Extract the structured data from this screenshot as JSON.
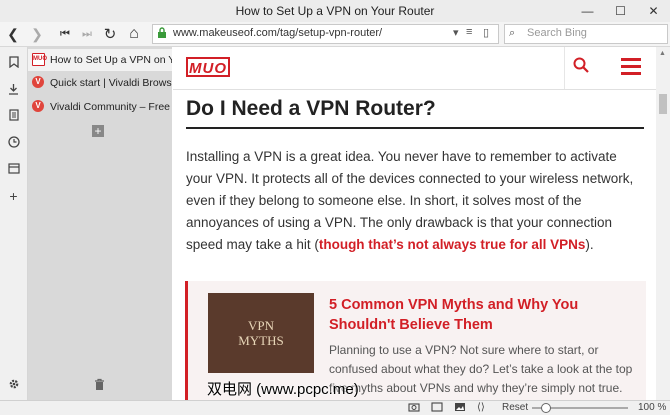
{
  "window": {
    "title": "How to Set Up a VPN on Your Router",
    "minimize": "—",
    "maximize": "☐",
    "close": "✕"
  },
  "nav": {
    "back": "❮",
    "forward": "❯",
    "first": "⏮",
    "fast_forward": "⏭",
    "reload": "↻",
    "home": "⌂",
    "url": "www.makeuseof.com/tag/setup-vpn-router/",
    "search_placeholder": "Search Bing"
  },
  "sidebar": {
    "icons": [
      "bookmark-icon",
      "download-icon",
      "notes-icon",
      "history-icon",
      "window-panel-icon",
      "add-panel-icon",
      "settings-icon"
    ]
  },
  "tabs": [
    {
      "label": "How to Set Up a VPN on You",
      "favicon": "MUO",
      "active": true
    },
    {
      "label": "Quick start | Vivaldi Browser",
      "favicon": "V",
      "active": false
    },
    {
      "label": "Vivaldi Community – Free we",
      "favicon": "V",
      "active": false
    }
  ],
  "site": {
    "logo": "MUO",
    "accent": "#d21f26"
  },
  "article": {
    "heading": "Do I Need a VPN Router?",
    "para_text": "Installing a VPN is a great idea. You never have to remember to activate your VPN. It protects all of the devices connected to your wireless network, even if they belong to someone else. In short, it solves most of the annoyances of using a VPN. The only drawback is that your connection speed may take a hit",
    "para_open": " (",
    "para_link": "though that’s not always true for all VPNs",
    "para_close": ")."
  },
  "related": {
    "image_text_1": "VPN",
    "image_text_2": "MYTHS",
    "title": "5 Common VPN Myths and Why You Shouldn't Believe Them",
    "desc": "Planning to use a VPN? Not sure where to start, or confused about what they do? Let’s take a look at the top five myths about VPNs and why they’re simply not true."
  },
  "status": {
    "reset": "Reset",
    "zoom": "100 %"
  },
  "watermark": "双电网 (www.pcpc.me)"
}
